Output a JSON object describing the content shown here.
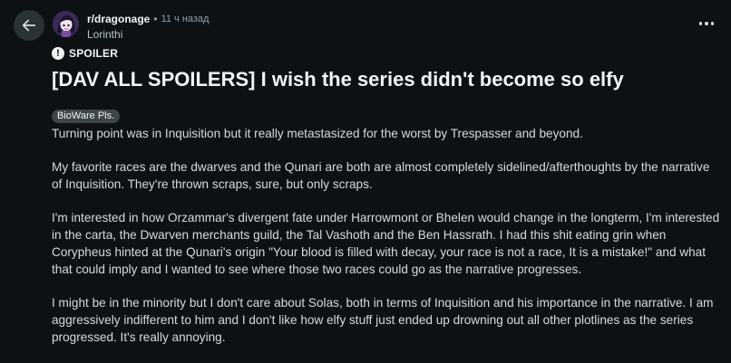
{
  "post": {
    "subreddit": "r/dragonage",
    "separator": "•",
    "time_ago": "11 ч назад",
    "author": "Lorinthi",
    "spoiler_label": "SPOILER",
    "spoiler_icon": "exclamation-icon",
    "title": "[DAV ALL SPOILERS] I wish the series didn't become so elfy",
    "flair": "BioWare Pls.",
    "paragraphs": [
      "Turning point was in Inquisition but it really metastasized for the worst by Trespasser and beyond.",
      "My favorite races are the dwarves and the Qunari are both are almost completely sidelined/afterthoughts by the narrative of Inquisition. They're thrown scraps, sure, but only scraps.",
      "I'm interested in how Orzammar's divergent fate under Harrowmont or Bhelen would change in the longterm, I'm interested in the carta, the Dwarven merchants guild, the Tal Vashoth and the Ben Hassrath. I had this shit eating grin when Corypheus hinted at the Qunari's origin \"Your blood is filled with decay, your race is not a race, It is a mistake!\" and what that could imply and I wanted to see where those two races could go as the narrative progresses.",
      "I might be in the minority but I don't care about Solas, both in terms of Inquisition and his importance in the narrative. I am aggressively indifferent to him and I don't like how elfy stuff just ended up drowning out all other plotlines as the series progressed. It's really annoying."
    ]
  },
  "icons": {
    "back": "arrow-left-icon",
    "more": "more-horizontal-icon"
  },
  "colors": {
    "background": "#0e1113",
    "text": "#d7dadc",
    "title": "#f2f4f5",
    "muted": "#8ba2ad",
    "flair_bg": "#3d4548",
    "button_bg": "#2a3236"
  }
}
